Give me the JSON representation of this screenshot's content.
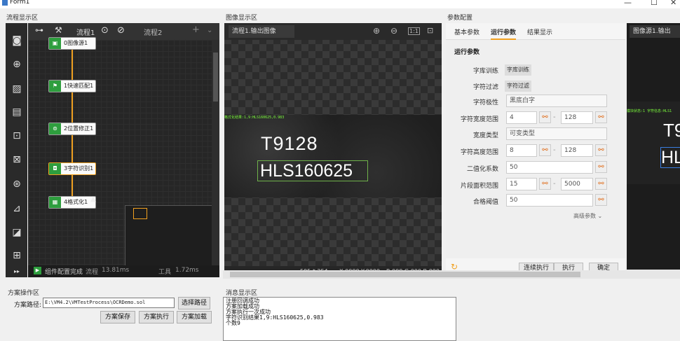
{
  "window": {
    "title": "Form1",
    "minimize": "—",
    "maximize": "☐",
    "close": "✕"
  },
  "sections": {
    "flow": "流程显示区",
    "image": "图像显示区",
    "params": "参数配置",
    "solution": "方案操作区",
    "message": "消息显示区"
  },
  "flow": {
    "tab1": "流程1",
    "tab2": "流程2",
    "nodes": [
      "0图像源1",
      "1快速匹配1",
      "2位置修正1",
      "3字符识别1",
      "4格式化1"
    ],
    "status": "组件配置完成",
    "flow_time_label": "流程",
    "flow_time": "13.81ms",
    "tool_time_label": "工具",
    "tool_time": "1.72ms"
  },
  "image": {
    "source_select": "流程1.输出图像",
    "overlay_text": "格式化结果:1,9:HLS160625,0.983",
    "text_line1": "T9128",
    "text_line2": "HLS160625",
    "size": "595 * 254",
    "coords": "X:0000  Y:0000",
    "rgb": "R:000  G:000  B:000"
  },
  "params": {
    "tabs": [
      "基本参数",
      "运行参数",
      "结果显示"
    ],
    "active_tab": 1,
    "group_title": "运行参数",
    "rows": [
      {
        "label": "字库训练",
        "pill": "字库训练"
      },
      {
        "label": "字符过滤",
        "pill": "字符过滤"
      },
      {
        "label": "字符极性",
        "value": "黑底白字"
      },
      {
        "label": "字符宽度范围",
        "min": "4",
        "max": "128"
      },
      {
        "label": "宽度类型",
        "value": "可变类型"
      },
      {
        "label": "字符高度范围",
        "min": "8",
        "max": "128"
      },
      {
        "label": "二值化系数",
        "value": "50"
      },
      {
        "label": "片段面积范围",
        "min": "15",
        "max": "5000"
      },
      {
        "label": "合格阈值",
        "value": "50"
      }
    ],
    "advanced": "高级参数",
    "buttons": {
      "continuous": "连续执行",
      "execute": "执行",
      "confirm": "确定"
    }
  },
  "right_panel": {
    "title": "图像源1.输出",
    "overlay": "模块状态:1 字符信息:HLS1",
    "text1": "T9",
    "text2": "HL"
  },
  "solution": {
    "path_label": "方案路径:",
    "path_value": "E:\\VM4.2\\VMTestProcess\\OCRDemo.sol",
    "select_path": "选择路径",
    "save": "方案保存",
    "execute": "方案执行",
    "load": "方案加载"
  },
  "messages": [
    "注册回调成功",
    "方案加载成功",
    "方案执行一次成功",
    "字符识别结果1,9:HLS160625,0.983",
    "个数9"
  ],
  "colors": {
    "accent": "#f0a020",
    "node_green": "#2e9e3e",
    "ocr_box": "#6fb24a",
    "overlay_text": "#7cff3c"
  }
}
